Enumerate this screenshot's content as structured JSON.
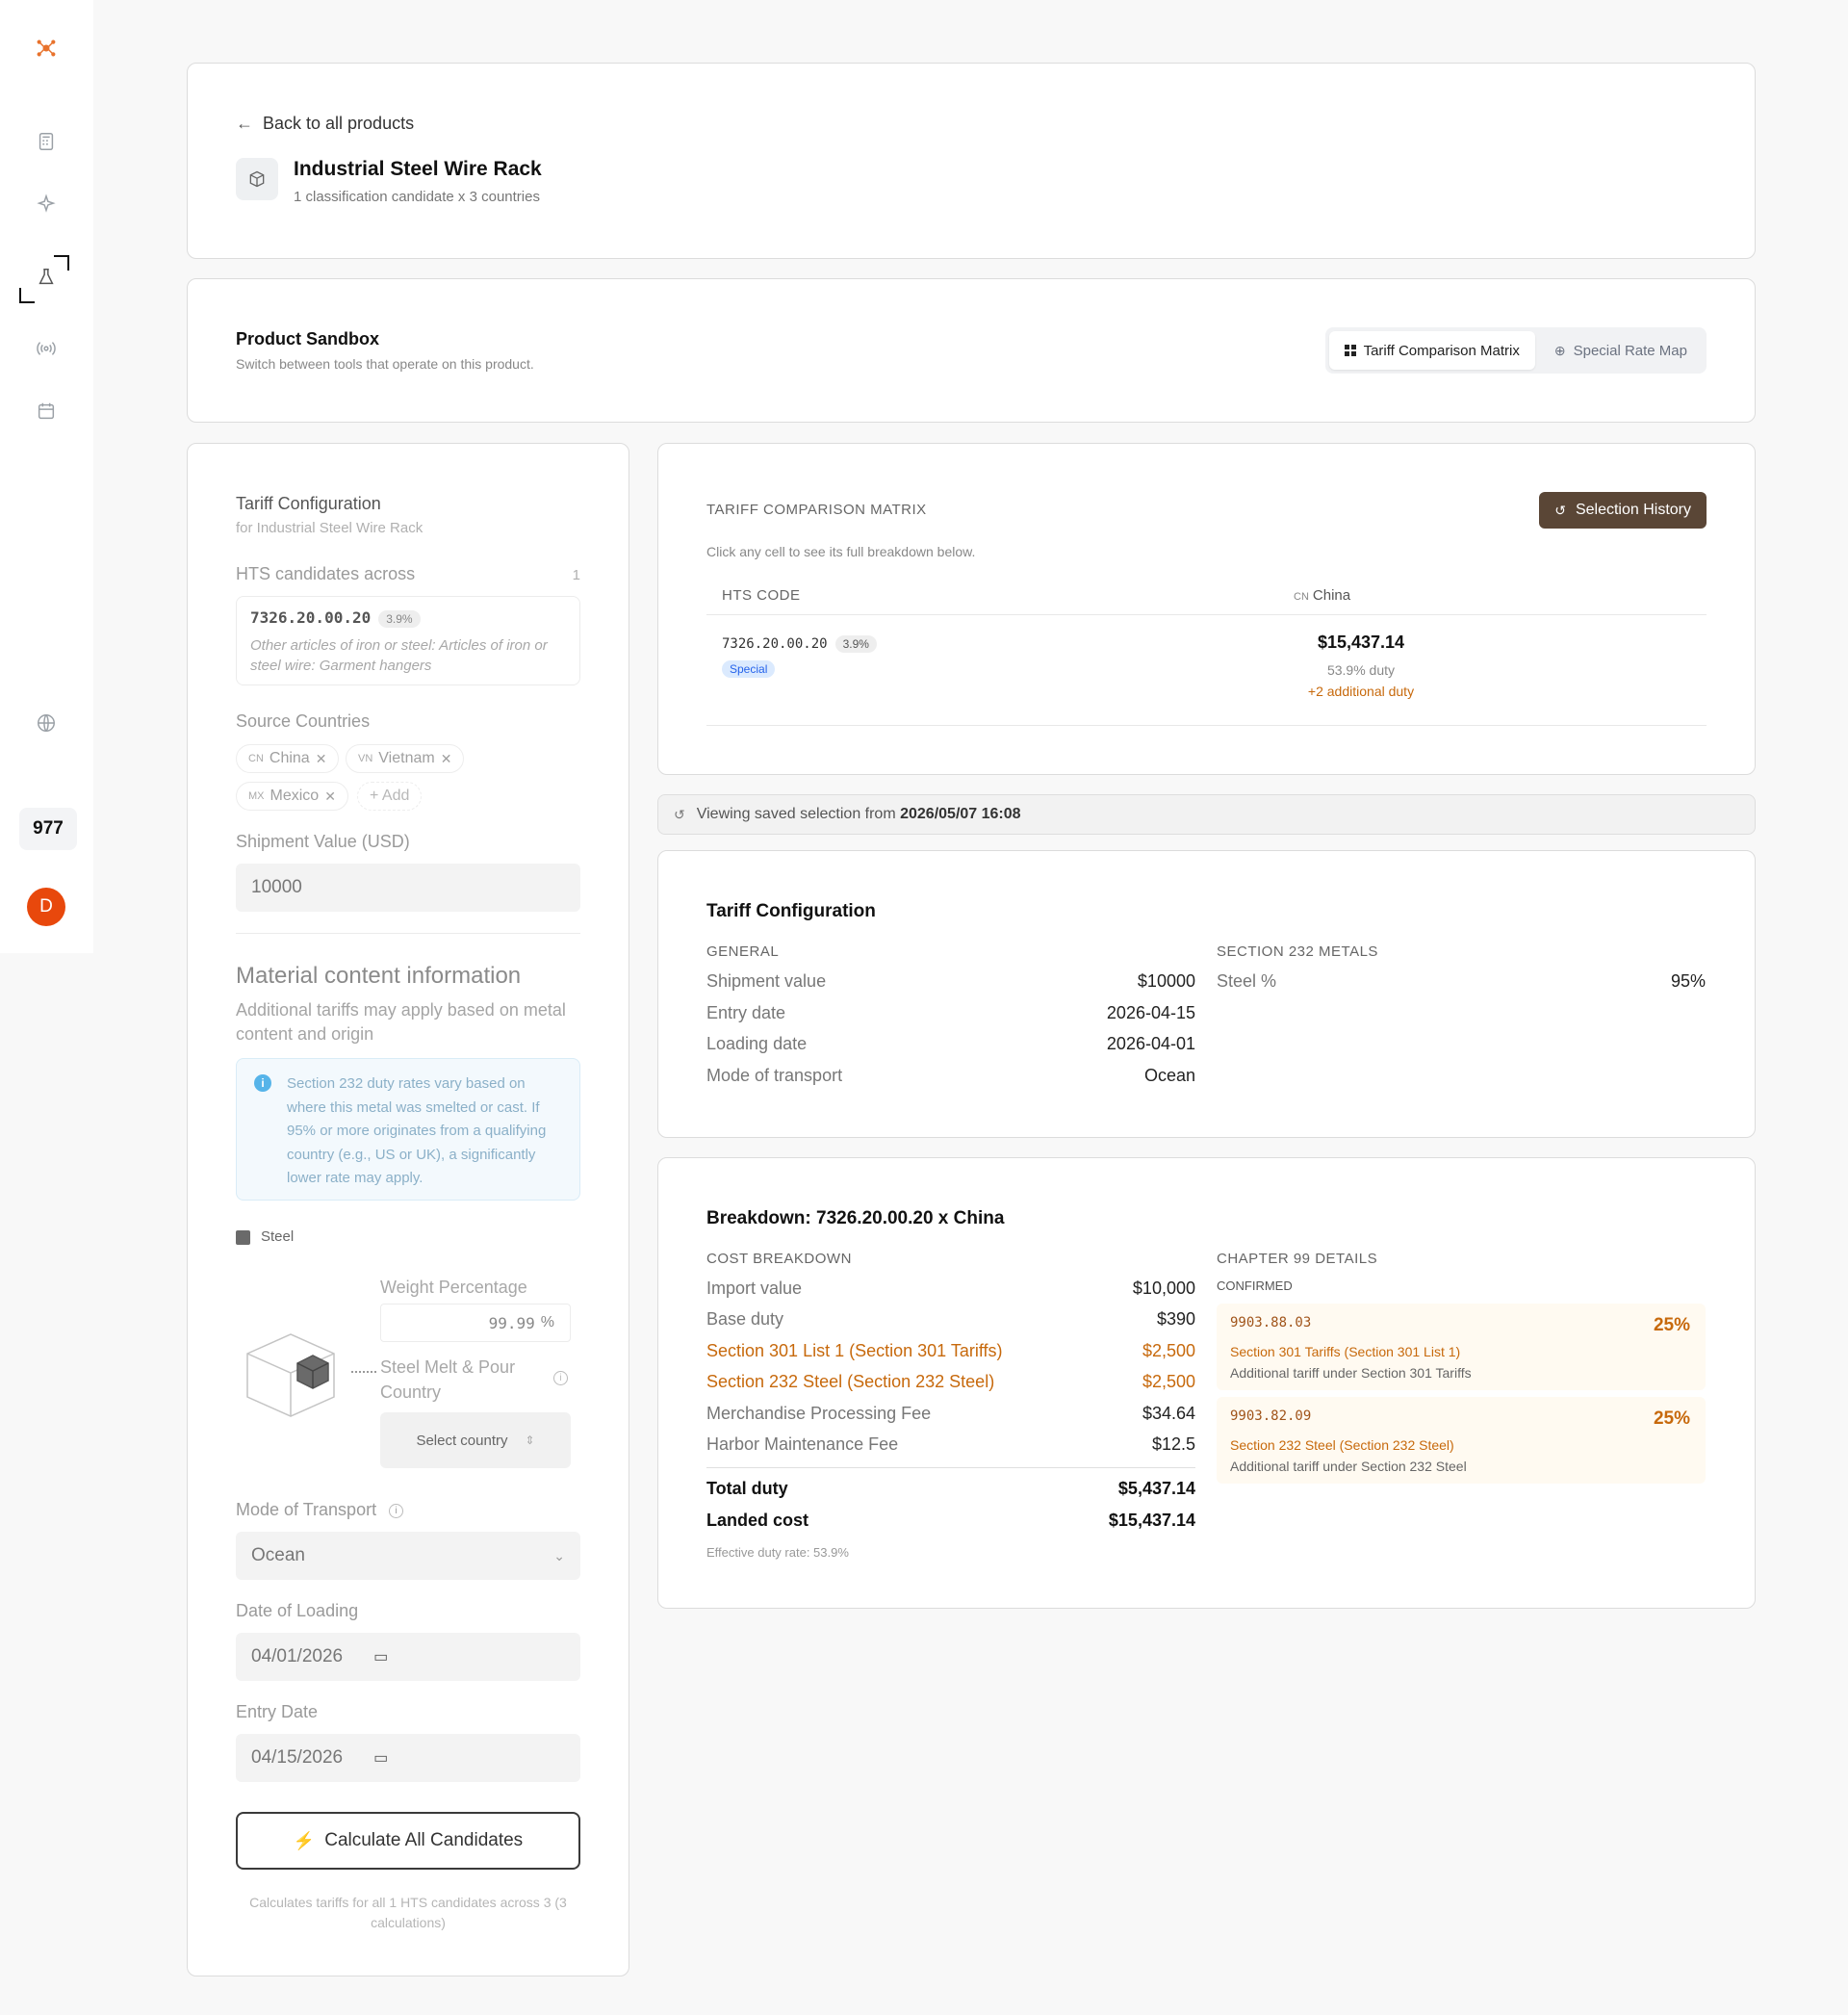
{
  "sidebar": {
    "count": "977",
    "avatar_initial": "D",
    "icons": [
      "logo-icon",
      "calculator-icon",
      "sparkle-icon",
      "flask-icon",
      "broadcast-icon",
      "calendar-icon",
      "globe-icon"
    ]
  },
  "header": {
    "back_label": "Back to all products",
    "product_title": "Industrial Steel Wire Rack",
    "product_subtitle": "1 classification candidate x 3 countries"
  },
  "sandbox": {
    "title": "Product Sandbox",
    "subtitle": "Switch between tools that operate on this product.",
    "tabs": [
      {
        "label": "Tariff Comparison Matrix",
        "active": true
      },
      {
        "label": "Special Rate Map",
        "active": false
      }
    ]
  },
  "config_panel": {
    "title": "Tariff Configuration",
    "subtitle": "for Industrial Steel Wire Rack",
    "hts_label": "HTS candidates across",
    "hts_count": "1",
    "hts": {
      "code": "7326.20.00.20",
      "rate": "3.9%",
      "description": "Other articles of iron or steel: Articles of iron or steel wire: Garment hangers"
    },
    "source_label": "Source Countries",
    "countries": [
      {
        "code": "CN",
        "name": "China"
      },
      {
        "code": "VN",
        "name": "Vietnam"
      },
      {
        "code": "MX",
        "name": "Mexico"
      }
    ],
    "add_label": "+ Add",
    "shipment_label": "Shipment Value (USD)",
    "shipment_value": "10000",
    "material_title": "Material content information",
    "material_subtitle": "Additional tariffs may apply based on metal content and origin",
    "info_text": "Section 232 duty rates vary based on where this metal was smelted or cast. If 95% or more originates from a qualifying country (e.g., US or UK), a significantly lower rate may apply.",
    "steel_label": "Steel",
    "weight_label": "Weight Percentage",
    "weight_value": "99.99",
    "weight_unit": "%",
    "melt_label": "Steel Melt & Pour Country",
    "melt_placeholder": "Select country",
    "transport_label": "Mode of Transport",
    "transport_value": "Ocean",
    "loading_label": "Date of Loading",
    "loading_value": "04/01/2026",
    "entry_label": "Entry Date",
    "entry_value": "04/15/2026",
    "calc_button": "Calculate All Candidates",
    "calc_note": "Calculates tariffs for all 1 HTS candidates across 3 (3 calculations)"
  },
  "matrix": {
    "title": "TARIFF COMPARISON MATRIX",
    "hint": "Click any cell to see its full breakdown below.",
    "history_button": "Selection History",
    "col_hts": "HTS CODE",
    "col_country_code": "CN",
    "col_country": "China",
    "row": {
      "code": "7326.20.00.20",
      "rate": "3.9%",
      "badge": "Special",
      "landed": "$15,437.14",
      "duty": "53.9% duty",
      "additional": "+2 additional duty"
    }
  },
  "banner": {
    "prefix": "Viewing saved selection from",
    "timestamp": "2026/05/07 16:08"
  },
  "tariff_config": {
    "title": "Tariff Configuration",
    "general_label": "GENERAL",
    "rows": [
      {
        "k": "Shipment value",
        "v": "$10000"
      },
      {
        "k": "Entry date",
        "v": "2026-04-15"
      },
      {
        "k": "Loading date",
        "v": "2026-04-01"
      },
      {
        "k": "Mode of transport",
        "v": "Ocean"
      }
    ],
    "metals_label": "SECTION 232 METALS",
    "metals": [
      {
        "k": "Steel %",
        "v": "95%"
      }
    ]
  },
  "breakdown": {
    "title": "Breakdown: 7326.20.00.20 x China",
    "cost_label": "COST BREAKDOWN",
    "rows": [
      {
        "k": "Import value",
        "v": "$10,000",
        "style": "normal"
      },
      {
        "k": "Base duty",
        "v": "$390",
        "style": "normal"
      },
      {
        "k": "Section 301 List 1 (Section 301 Tariffs)",
        "v": "$2,500",
        "style": "orange"
      },
      {
        "k": "Section 232 Steel (Section 232 Steel)",
        "v": "$2,500",
        "style": "orange"
      },
      {
        "k": "Merchandise Processing Fee",
        "v": "$34.64",
        "style": "normal"
      },
      {
        "k": "Harbor Maintenance Fee",
        "v": "$12.5",
        "style": "normal"
      }
    ],
    "total_duty_label": "Total duty",
    "total_duty": "$5,437.14",
    "landed_label": "Landed cost",
    "landed": "$15,437.14",
    "effective": "Effective duty rate: 53.9%",
    "ch99_label": "CHAPTER 99 DETAILS",
    "confirmed_label": "CONFIRMED",
    "ch99": [
      {
        "code": "9903.88.03",
        "rate": "25%",
        "title": "Section 301 Tariffs (Section 301 List 1)",
        "desc": "Additional tariff under Section 301 Tariffs"
      },
      {
        "code": "9903.82.09",
        "rate": "25%",
        "title": "Section 232 Steel (Section 232 Steel)",
        "desc": "Additional tariff under Section 232 Steel"
      }
    ]
  },
  "colors": {
    "accent_orange": "#c7690c",
    "history_button": "#5a4636",
    "avatar": "#e8480c"
  }
}
